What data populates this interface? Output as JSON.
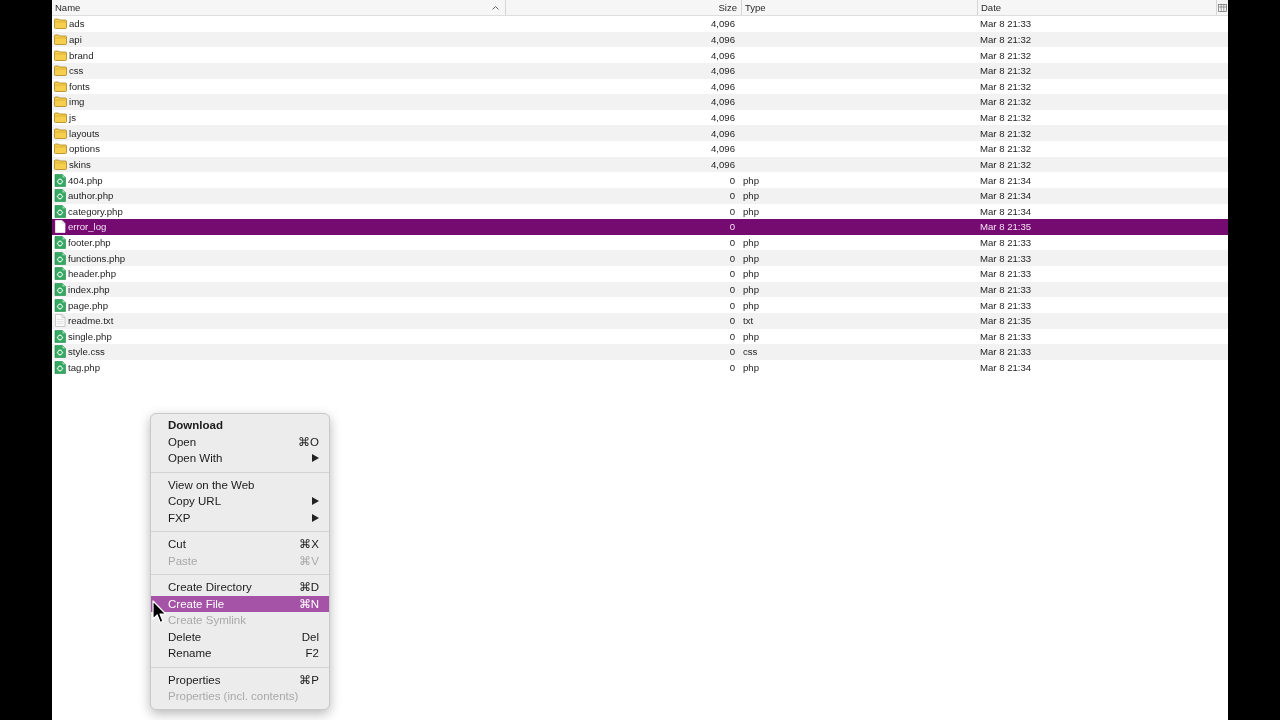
{
  "file_list": {
    "columns": [
      {
        "label": "Name",
        "sorted": true
      },
      {
        "label": "Size",
        "sorted": false
      },
      {
        "label": "Type",
        "sorted": false
      },
      {
        "label": "Date",
        "sorted": false
      }
    ],
    "rows": [
      {
        "name": "ads",
        "kind": "folder",
        "size": "4,096",
        "date": "Mar 8 21:33",
        "selected": false
      },
      {
        "name": "api",
        "kind": "folder",
        "size": "4,096",
        "date": "Mar 8 21:32",
        "selected": false
      },
      {
        "name": "brand",
        "kind": "folder",
        "size": "4,096",
        "date": "Mar 8 21:32",
        "selected": false
      },
      {
        "name": "css",
        "kind": "folder",
        "size": "4,096",
        "date": "Mar 8 21:32",
        "selected": false
      },
      {
        "name": "fonts",
        "kind": "folder",
        "size": "4,096",
        "date": "Mar 8 21:32",
        "selected": false
      },
      {
        "name": "img",
        "kind": "folder",
        "size": "4,096",
        "date": "Mar 8 21:32",
        "selected": false
      },
      {
        "name": "js",
        "kind": "folder",
        "size": "4,096",
        "date": "Mar 8 21:32",
        "selected": false
      },
      {
        "name": "layouts",
        "kind": "folder",
        "size": "4,096",
        "date": "Mar 8 21:32",
        "selected": false
      },
      {
        "name": "options",
        "kind": "folder",
        "size": "4,096",
        "date": "Mar 8 21:32",
        "selected": false
      },
      {
        "name": "skins",
        "kind": "folder",
        "size": "4,096",
        "date": "Mar 8 21:32",
        "selected": false
      },
      {
        "name": "404.php",
        "kind": "script",
        "size": "0",
        "type": "php",
        "date": "Mar 8 21:34",
        "selected": false
      },
      {
        "name": "author.php",
        "kind": "script",
        "size": "0",
        "type": "php",
        "date": "Mar 8 21:34",
        "selected": false
      },
      {
        "name": "category.php",
        "kind": "script",
        "size": "0",
        "type": "php",
        "date": "Mar 8 21:34",
        "selected": false
      },
      {
        "name": "error_log",
        "kind": "blank",
        "size": "0",
        "date": "Mar 8 21:35",
        "selected": true
      },
      {
        "name": "footer.php",
        "kind": "script",
        "size": "0",
        "type": "php",
        "date": "Mar 8 21:33",
        "selected": false
      },
      {
        "name": "functions.php",
        "kind": "script",
        "size": "0",
        "type": "php",
        "date": "Mar 8 21:33",
        "selected": false
      },
      {
        "name": "header.php",
        "kind": "script",
        "size": "0",
        "type": "php",
        "date": "Mar 8 21:33",
        "selected": false
      },
      {
        "name": "index.php",
        "kind": "script",
        "size": "0",
        "type": "php",
        "date": "Mar 8 21:33",
        "selected": false
      },
      {
        "name": "page.php",
        "kind": "script",
        "size": "0",
        "type": "php",
        "date": "Mar 8 21:33",
        "selected": false
      },
      {
        "name": "readme.txt",
        "kind": "text",
        "size": "0",
        "type": "txt",
        "date": "Mar 8 21:35",
        "selected": false
      },
      {
        "name": "single.php",
        "kind": "script",
        "size": "0",
        "type": "php",
        "date": "Mar 8 21:33",
        "selected": false
      },
      {
        "name": "style.css",
        "kind": "script",
        "size": "0",
        "type": "css",
        "date": "Mar 8 21:33",
        "selected": false
      },
      {
        "name": "tag.php",
        "kind": "script",
        "size": "0",
        "type": "php",
        "date": "Mar 8 21:34",
        "selected": false
      }
    ]
  },
  "context_menu": {
    "groups": [
      {
        "items": [
          {
            "label": "Download",
            "default": true,
            "submenu": false,
            "disabled": false,
            "selected": false
          },
          {
            "label": "Open",
            "shortcut": "⌘O",
            "default": false,
            "submenu": false,
            "disabled": false,
            "selected": false
          },
          {
            "label": "Open With",
            "default": false,
            "submenu": true,
            "disabled": false,
            "selected": false
          }
        ]
      },
      {
        "items": [
          {
            "label": "View on the Web",
            "default": false,
            "submenu": false,
            "disabled": false,
            "selected": false
          },
          {
            "label": "Copy URL",
            "default": false,
            "submenu": true,
            "disabled": false,
            "selected": false
          },
          {
            "label": "FXP",
            "default": false,
            "submenu": true,
            "disabled": false,
            "selected": false
          }
        ]
      },
      {
        "items": [
          {
            "label": "Cut",
            "shortcut": "⌘X",
            "default": false,
            "submenu": false,
            "disabled": false,
            "selected": false
          },
          {
            "label": "Paste",
            "shortcut": "⌘V",
            "default": false,
            "submenu": false,
            "disabled": true,
            "selected": false
          }
        ]
      },
      {
        "items": [
          {
            "label": "Create Directory",
            "shortcut": "⌘D",
            "default": false,
            "submenu": false,
            "disabled": false,
            "selected": false
          },
          {
            "label": "Create File",
            "shortcut": "⌘N",
            "default": false,
            "submenu": false,
            "disabled": false,
            "selected": true
          },
          {
            "label": "Create Symlink",
            "default": false,
            "submenu": false,
            "disabled": true,
            "selected": false
          },
          {
            "label": "Delete",
            "shortcut": "Del",
            "default": false,
            "submenu": false,
            "disabled": false,
            "selected": false
          },
          {
            "label": "Rename",
            "shortcut": "F2",
            "default": false,
            "submenu": false,
            "disabled": false,
            "selected": false
          }
        ]
      },
      {
        "items": [
          {
            "label": "Properties",
            "shortcut": "⌘P",
            "default": false,
            "submenu": false,
            "disabled": false,
            "selected": false
          },
          {
            "label": "Properties (incl. contents)",
            "default": false,
            "submenu": false,
            "disabled": true,
            "selected": false
          }
        ]
      }
    ]
  }
}
